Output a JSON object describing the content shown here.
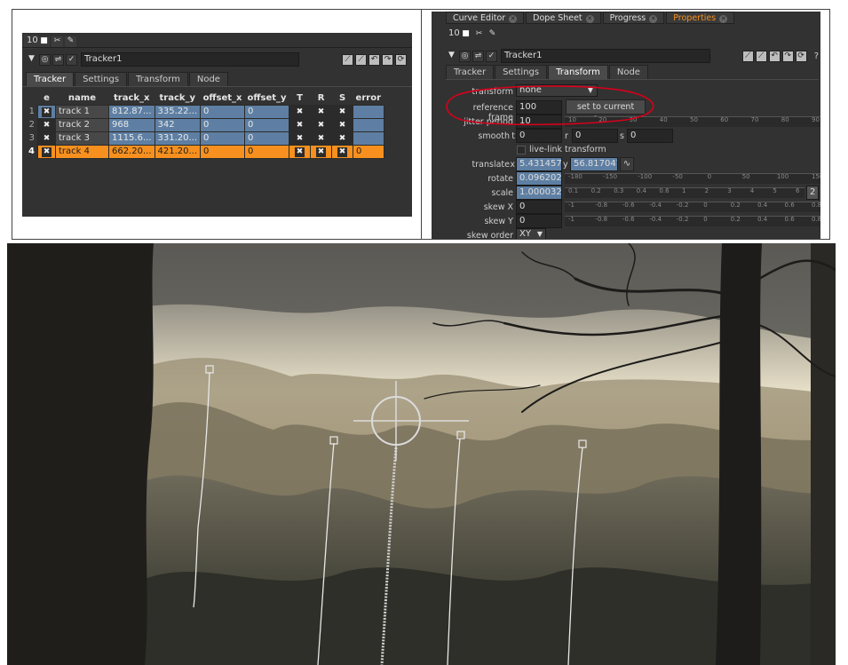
{
  "left_panel": {
    "frame_number": "10",
    "node_name": "Tracker1",
    "tabs": [
      "Tracker",
      "Settings",
      "Transform",
      "Node"
    ],
    "active_tab": "Tracker",
    "table": {
      "headers": [
        "e",
        "name",
        "track_x",
        "track_y",
        "offset_x",
        "offset_y",
        "T",
        "R",
        "S",
        "error"
      ],
      "rows": [
        {
          "num": "1",
          "name": "track 1",
          "track_x": "812.87...",
          "track_y": "335.22...",
          "offset_x": "0",
          "offset_y": "0",
          "error": ""
        },
        {
          "num": "2",
          "name": "track 2",
          "track_x": "968",
          "track_y": "342",
          "offset_x": "0",
          "offset_y": "0",
          "error": ""
        },
        {
          "num": "3",
          "name": "track 3",
          "track_x": "1115.6...",
          "track_y": "331.20...",
          "offset_x": "0",
          "offset_y": "0",
          "error": ""
        },
        {
          "num": "4",
          "name": "track 4",
          "track_x": "662.20...",
          "track_y": "421.20...",
          "offset_x": "0",
          "offset_y": "0",
          "error": "0"
        }
      ]
    }
  },
  "right_panel": {
    "frame_number": "10",
    "pane_tabs": [
      "Curve Editor",
      "Dope Sheet",
      "Progress",
      "Properties"
    ],
    "active_pane_tab": "Properties",
    "node_name": "Tracker1",
    "tabs": [
      "Tracker",
      "Settings",
      "Transform",
      "Node"
    ],
    "active_tab": "Transform",
    "help_glyph": "?",
    "params": {
      "transform_label": "transform",
      "transform_value": "none",
      "reference_frame_label": "reference frame",
      "reference_frame_value": "100",
      "set_current_frame_label": "set to current frame",
      "jitter_period_label": "jitter period",
      "jitter_period_value": "10",
      "smooth_label": "smooth",
      "smooth_t_label": "t",
      "smooth_t_value": "0",
      "smooth_r_label": "r",
      "smooth_r_value": "0",
      "smooth_s_label": "s",
      "smooth_s_value": "0",
      "live_link_label": "live-link transform",
      "translate_label": "translate",
      "translate_x_label": "x",
      "translate_x_value": "5.43145752",
      "translate_y_label": "y",
      "translate_y_value": "56.8170471",
      "rotate_label": "rotate",
      "rotate_value": "0.09620216",
      "scale_label": "scale",
      "scale_value": "1.00003294",
      "skew_x_label": "skew X",
      "skew_x_value": "0",
      "skew_y_label": "skew Y",
      "skew_y_value": "0",
      "skew_order_label": "skew order",
      "skew_order_value": "XY",
      "scale_field_2": "2"
    },
    "slider_ticks": {
      "jitter": [
        "10",
        "20",
        "30",
        "40",
        "50",
        "60",
        "70",
        "80",
        "90"
      ],
      "rotate": [
        "-180",
        "-150",
        "-100",
        "-50",
        "0",
        "50",
        "100",
        "150"
      ],
      "scale": [
        "0.1",
        "0.2",
        "0.3",
        "0.4",
        "0.6",
        "1",
        "2",
        "3",
        "4",
        "5",
        "6"
      ],
      "skew": [
        "-1",
        "-0.8",
        "-0.6",
        "-0.4",
        "-0.2",
        "0",
        "0.2",
        "0.4",
        "0.6",
        "0.8"
      ]
    },
    "annotation_color": "#d8001a"
  },
  "viewer": {
    "sky_color": "#c9b58c",
    "mountain_color": "#7d7767",
    "tree_color": "#1d1c1a",
    "tracker_widget": "crosshair-tracker"
  }
}
